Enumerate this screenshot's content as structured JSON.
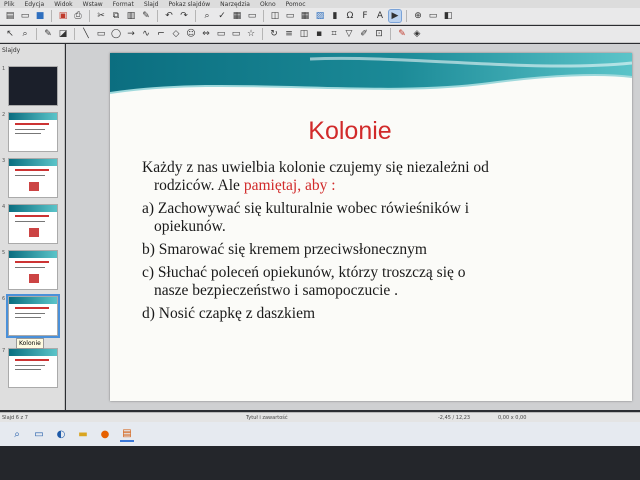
{
  "menubar": {
    "items": [
      "Plik",
      "Edycja",
      "Widok",
      "Wstaw",
      "Format",
      "Slajd",
      "Pokaz slajdów",
      "Narzędzia",
      "Okno",
      "Pomoc"
    ]
  },
  "toolbar1": {
    "icons": [
      "new-icon",
      "open-icon",
      "save-icon",
      "export-pdf-icon",
      "print-icon",
      "cut-icon",
      "copy-icon",
      "paste-icon",
      "clone-icon",
      "undo-icon",
      "redo-icon",
      "find-replace-icon",
      "spelling-icon",
      "grid-icon",
      "display-views-icon",
      "master-slide-icon",
      "new-slide-icon",
      "table-icon",
      "image-icon",
      "chart-icon",
      "special-character-icon",
      "fontwork-icon",
      "text-box-icon",
      "start-show-icon"
    ]
  },
  "toolbar2": {
    "icons": [
      "select-icon",
      "zoom-icon",
      "line-color-icon",
      "fill-color-icon",
      "line-icon",
      "rectangle-icon",
      "ellipse-icon",
      "arrow-icon",
      "curve-icon",
      "connector-icon",
      "basic-shapes-icon",
      "symbol-shapes-icon",
      "block-arrows-icon",
      "flowchart-icon",
      "callouts-icon",
      "stars-icon",
      "rotate-icon",
      "align-icon",
      "arrange-icon",
      "shadow-icon",
      "crop-icon",
      "filter-icon",
      "points-icon",
      "glue-icon"
    ]
  },
  "slides_panel": {
    "header": "Slajdy",
    "slides": [
      {
        "num": "1"
      },
      {
        "num": "2"
      },
      {
        "num": "3"
      },
      {
        "num": "4"
      },
      {
        "num": "5"
      },
      {
        "num": "6"
      },
      {
        "num": "7"
      }
    ],
    "tooltip": "Kolonie"
  },
  "slide": {
    "title": "Kolonie",
    "intro_a": "Każdy z nas uwielbia kolonie czujemy się niezależni od",
    "intro_b": "rodziców. Ale ",
    "intro_highlight": "pamiętaj, aby :",
    "items": [
      {
        "a": "a) Zachowywać się kulturalnie wobec rówieśników  i",
        "b": "opiekunów."
      },
      {
        "a": "b) Smarować się kremem przeciwsłonecznym",
        "b": ""
      },
      {
        "a": "c) Słuchać poleceń opiekunów, którzy troszczą się o",
        "b": "nasze bezpieczeństwo i samopoczucie ."
      },
      {
        "a": "d) Nosić czapkę z daszkiem",
        "b": ""
      }
    ],
    "colors": {
      "title": "#d12a2a",
      "highlight": "#d12a2a",
      "wave_dark": "#0b6e80",
      "wave_light": "#5bc4c9"
    }
  },
  "statusbar": {
    "slide_info": "Slajd 6 z 7",
    "layout": "Tytuł i zawartość",
    "position": "-2,45 / 12,23",
    "size": "0,00 x 0,00"
  },
  "taskbar": {
    "icons": [
      "search-icon",
      "task-view-icon",
      "edge-icon",
      "file-explorer-icon",
      "firefox-icon",
      "impress-icon"
    ]
  }
}
